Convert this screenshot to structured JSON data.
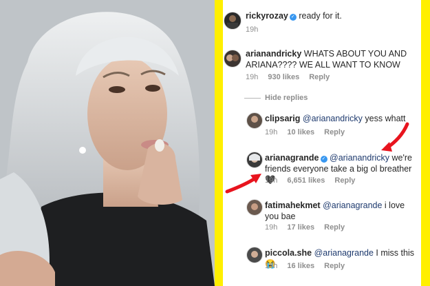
{
  "comments": [
    {
      "username": "rickyrozay",
      "verified": true,
      "text": "ready for it.",
      "time": "19h",
      "likes": "",
      "reply": ""
    },
    {
      "username": "arianandricky",
      "verified": false,
      "text": "WHATS ABOUT YOU AND ARIANA???? WE ALL WANT TO KNOW",
      "time": "19h",
      "likes": "930 likes",
      "reply": "Reply"
    }
  ],
  "hide_replies": "Hide replies",
  "replies": [
    {
      "username": "clipsarig",
      "verified": false,
      "mention": "@arianandricky",
      "text": "yess whatt",
      "time": "19h",
      "likes": "10 likes",
      "reply": "Reply"
    },
    {
      "username": "arianagrande",
      "verified": true,
      "mention": "@arianandricky",
      "text": "we're friends everyone take a big ol breather 🖤",
      "time": "19h",
      "likes": "6,651 likes",
      "reply": "Reply"
    },
    {
      "username": "fatimahekmet",
      "verified": false,
      "mention": "@arianagrande",
      "text": "i love you bae",
      "time": "19h",
      "likes": "17 likes",
      "reply": "Reply"
    },
    {
      "username": "piccola.she",
      "verified": false,
      "mention": "@arianagrande",
      "text": "I miss this😭",
      "time": "19h",
      "likes": "16 likes",
      "reply": "Reply"
    }
  ],
  "colors": {
    "stripe": "#ffef00",
    "arrow": "#e8141e",
    "verified": "#3897f0",
    "mention": "#1e3a6e"
  },
  "icons": [
    "verified-badge-icon",
    "red-arrow-icon",
    "black-heart-emoji",
    "crying-emoji"
  ]
}
